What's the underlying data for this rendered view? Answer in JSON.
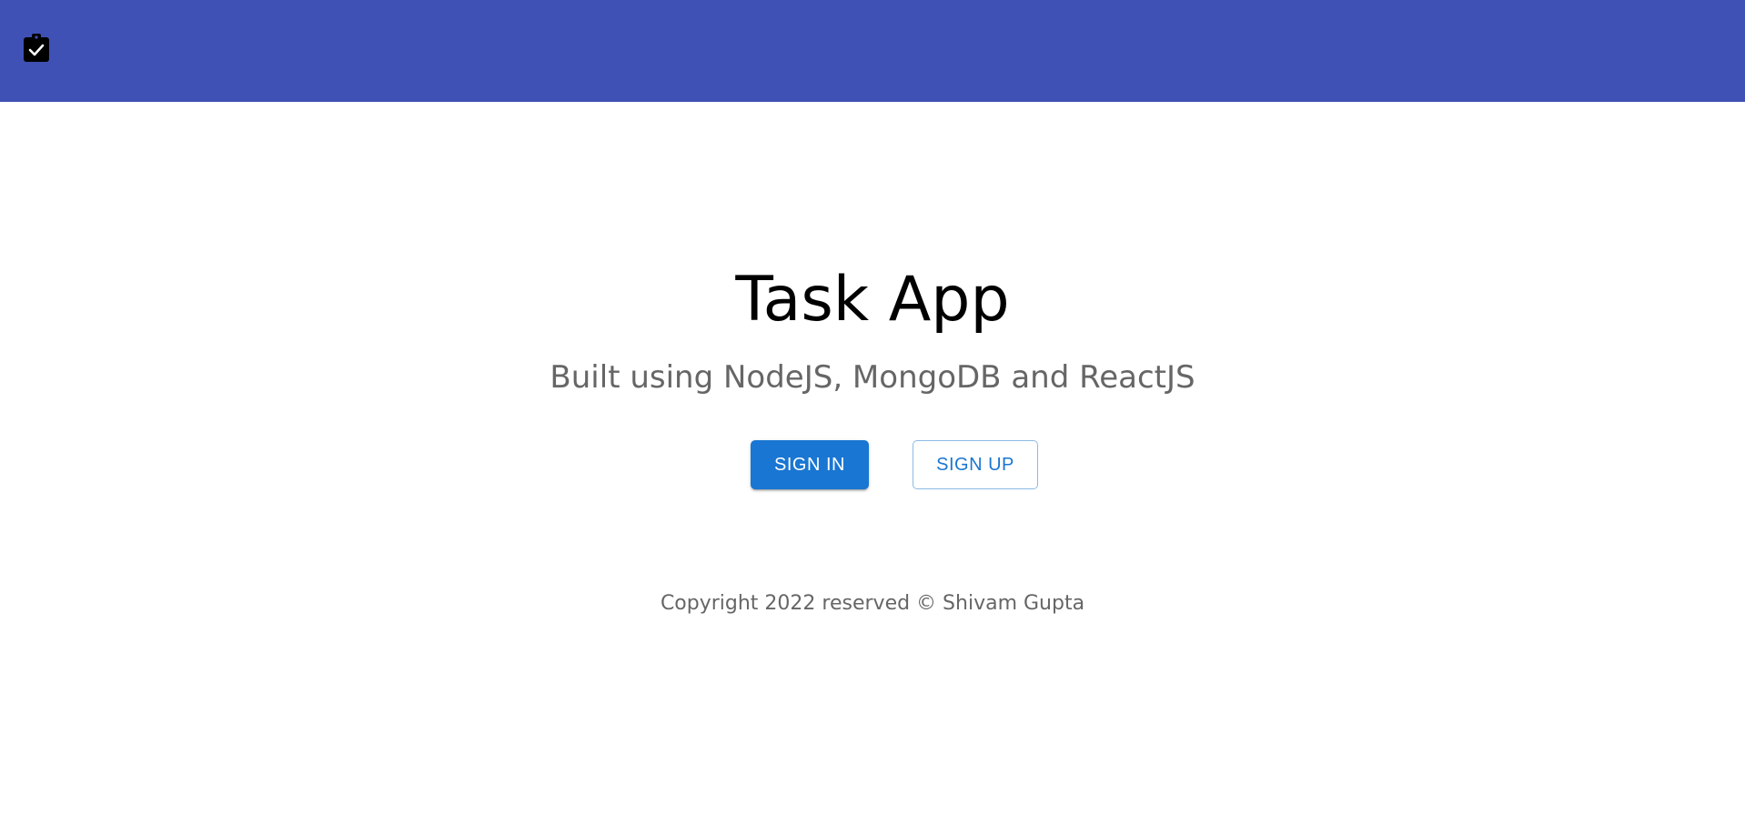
{
  "appbar": {
    "background_color": "#3f51b5",
    "icon": "clipboard-check-icon"
  },
  "hero": {
    "title": "Task App",
    "subtitle": "Built using NodeJS, MongoDB and ReactJS"
  },
  "actions": {
    "sign_in_label": "SIGN IN",
    "sign_up_label": "SIGN UP",
    "primary_color": "#1976d2"
  },
  "footer": {
    "copyright": "Copyright 2022 reserved © Shivam Gupta"
  }
}
